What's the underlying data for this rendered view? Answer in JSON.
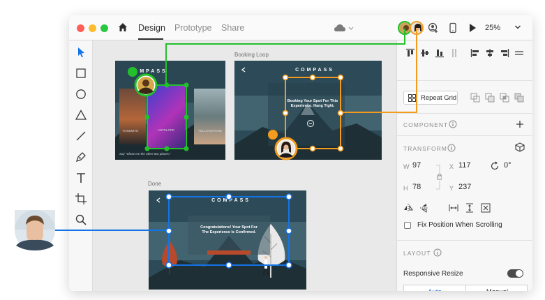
{
  "window": {
    "tabs": [
      {
        "label": "Design",
        "active": true
      },
      {
        "label": "Prototype",
        "active": false
      },
      {
        "label": "Share",
        "active": false
      }
    ],
    "zoom": "25%"
  },
  "canvas": {
    "artboards": [
      {
        "title": "",
        "brand": "MPASS"
      },
      {
        "title": "Booking Loop",
        "brand": "COMPASS",
        "message": "Booking Your Spot For This Experience. Hang Tight."
      },
      {
        "title": "Done",
        "brand": "COMPASS",
        "message": "Congratulations! Your Spot For The Experience Is Confirmed."
      }
    ],
    "card_captions": [
      "YOSEMITE",
      "ANTELOPE",
      "YELLOWSTONE"
    ],
    "quote": "Say \"Show me the other two places.\""
  },
  "panel": {
    "repeat_grid": "Repeat Grid",
    "component_label": "COMPONENT",
    "transform_label": "TRANSFORM",
    "w_label": "W",
    "w_value": "97",
    "x_label": "X",
    "x_value": "117",
    "rotation_value": "0°",
    "h_label": "H",
    "h_value": "78",
    "y_label": "Y",
    "y_value": "237",
    "fix_position_label": "Fix Position When Scrolling",
    "layout_label": "LAYOUT",
    "responsive_resize_label": "Responsive Resize",
    "responsive_resize_on": true,
    "resize_modes": [
      "Auto",
      "Manual"
    ],
    "resize_mode_selected": "Auto"
  },
  "colors": {
    "green": "#22c12c",
    "orange": "#f29b1d",
    "blue": "#1473e6",
    "artboard_bg": "#2b4957"
  }
}
